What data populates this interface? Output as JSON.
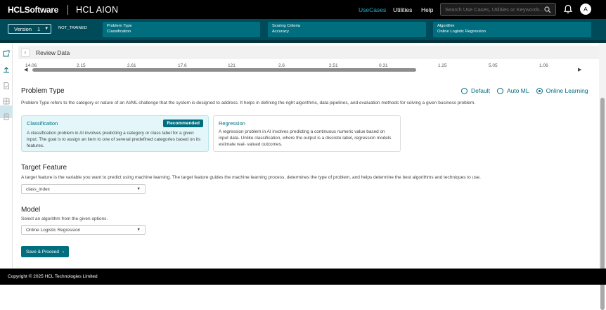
{
  "header": {
    "brand": "HCLSoftware",
    "product": "HCL AION",
    "nav": {
      "usecases": "UseCases",
      "utilities": "Utilities",
      "help": "Help"
    },
    "search_placeholder": "Search Use Cases, Utilities or Keywords...",
    "avatar_initial": "A",
    "accent_color": "#21b5c8"
  },
  "config": {
    "version_label": "Version",
    "version_value": "1",
    "status": "NOT_TRAINED",
    "cards": [
      {
        "label": "Problem Type",
        "value": "Classification"
      },
      {
        "label": "Scoring Criteria",
        "value": "Accuracy"
      },
      {
        "label": "Algorithm",
        "value": "Online Logistic Regression"
      }
    ]
  },
  "review": {
    "title": "Review Data",
    "row_values": [
      "14.06",
      "2.15",
      "2.61",
      "17.6",
      "121",
      "2.6",
      "2.51",
      "0.31",
      "1.25",
      "5.05",
      "1.06"
    ]
  },
  "problem_type": {
    "heading": "Problem Type",
    "description": "Problem Type refers to the category or nature of an AI/ML challenge that the system is designed to address. It helps in defining the right algorithms, data pipelines, and evaluation methods for solving a given business problem.",
    "modes": [
      "Default",
      "Auto ML",
      "Online Learning"
    ],
    "selected_mode": "Online Learning",
    "options": [
      {
        "title": "Classification",
        "badge": "Recommended",
        "text": "A classification problem in AI involves predicting a category or class label for a given input. The goal is to assign an item to one of several predefined categories based on its features."
      },
      {
        "title": "Regression",
        "text": "A regression problem in AI involves predicting a continuous numeric value based on input data. Unlike classification, where the output is a discrete label, regression models estimate real- valued outcomes."
      }
    ]
  },
  "target_feature": {
    "heading": "Target Feature",
    "description": "A target feature is the variable you want to predict using machine learning. The target feature guides the machine learning process, determines the type of problem, and helps determine the best algorithms and techniques to use.",
    "value": "class_index"
  },
  "model": {
    "heading": "Model",
    "description": "Select an algorithm from the given options.",
    "value": "Online Logistic Regression"
  },
  "actions": {
    "save_label": "Save & Proceed"
  },
  "footer": {
    "copyright": "Copyright © 2025 HCL Technologies Limited"
  }
}
